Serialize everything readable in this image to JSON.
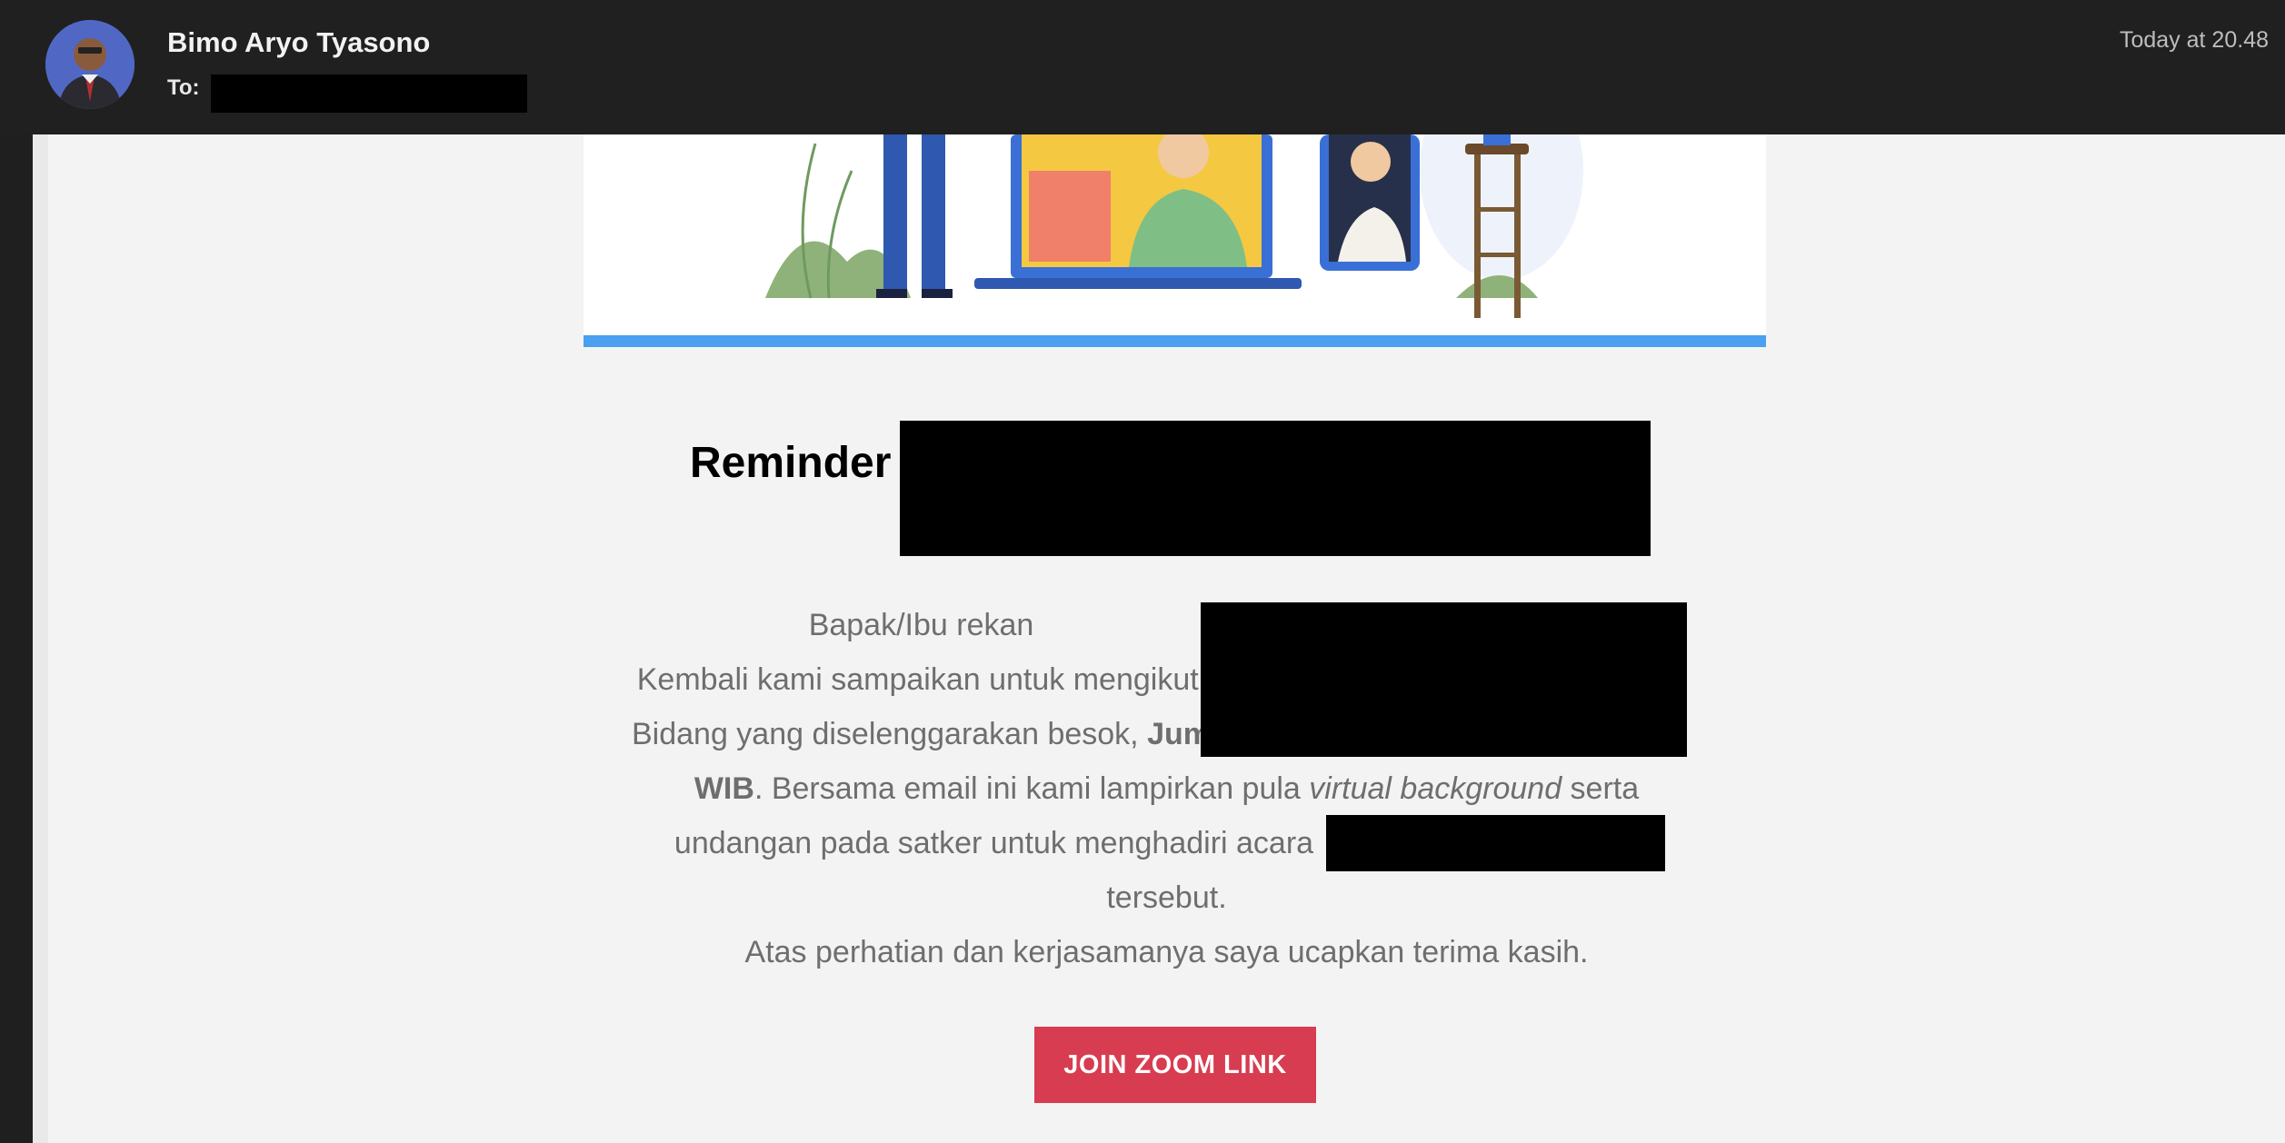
{
  "header": {
    "sender_name": "Bimo Aryo Tyasono",
    "to_label": "To:",
    "timestamp": "Today at 20.48"
  },
  "email": {
    "title": "Reminder",
    "lines": {
      "l1": "Bapak/Ibu rekan",
      "l2": "Kembali kami sampaikan untuk mengikuti",
      "l3a": "Bidang yang diselenggarakan besok,",
      "l3b": "Jum",
      "l4a": "WIB",
      "l4b": ". Bersama email ini kami lampirkan pula ",
      "l4c": "virtual background",
      "l4d": " serta",
      "l5": "undangan pada satker untuk menghadiri acara",
      "l6": "tersebut.",
      "l7": "Atas perhatian dan kerjasamanya saya ucapkan terima kasih."
    },
    "button_label": "JOIN ZOOM LINK"
  },
  "colors": {
    "header_bg": "#202020",
    "button": "#d83c50",
    "hero_bar": "#4a9ff0"
  }
}
